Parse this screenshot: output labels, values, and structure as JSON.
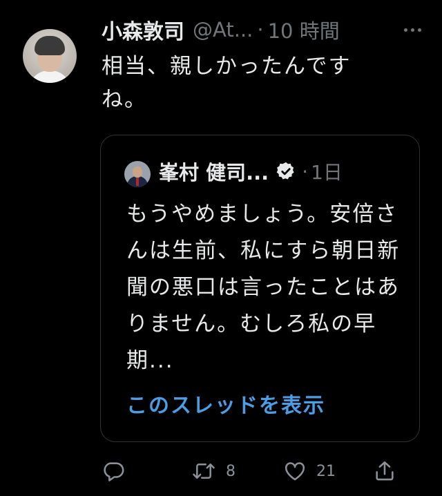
{
  "tweet": {
    "author_name": "小森敦司",
    "handle": "@At...",
    "separator": "·",
    "time": "10 時間",
    "text": "相当、親しかったんですね。",
    "avatar": "profile-photo"
  },
  "quote": {
    "author_name": "峯村 健司...",
    "verified_icon": "verified-badge-icon",
    "separator": "·",
    "time": "1日",
    "text": "もうやめましょう。安倍さんは生前、私にすら朝日新聞の悪口は言ったことはありません。むしろ私の早期...",
    "show_thread": "このスレッドを表示",
    "link_color": "#4a9ee8"
  },
  "actions": {
    "reply_icon": "reply-icon",
    "retweet_icon": "retweet-icon",
    "retweet_count": "8",
    "like_icon": "heart-icon",
    "like_count": "21",
    "share_icon": "share-icon"
  },
  "colors": {
    "background": "#000000",
    "text": "#e7e9ea",
    "secondary": "#71767b",
    "border": "#2f3336"
  }
}
